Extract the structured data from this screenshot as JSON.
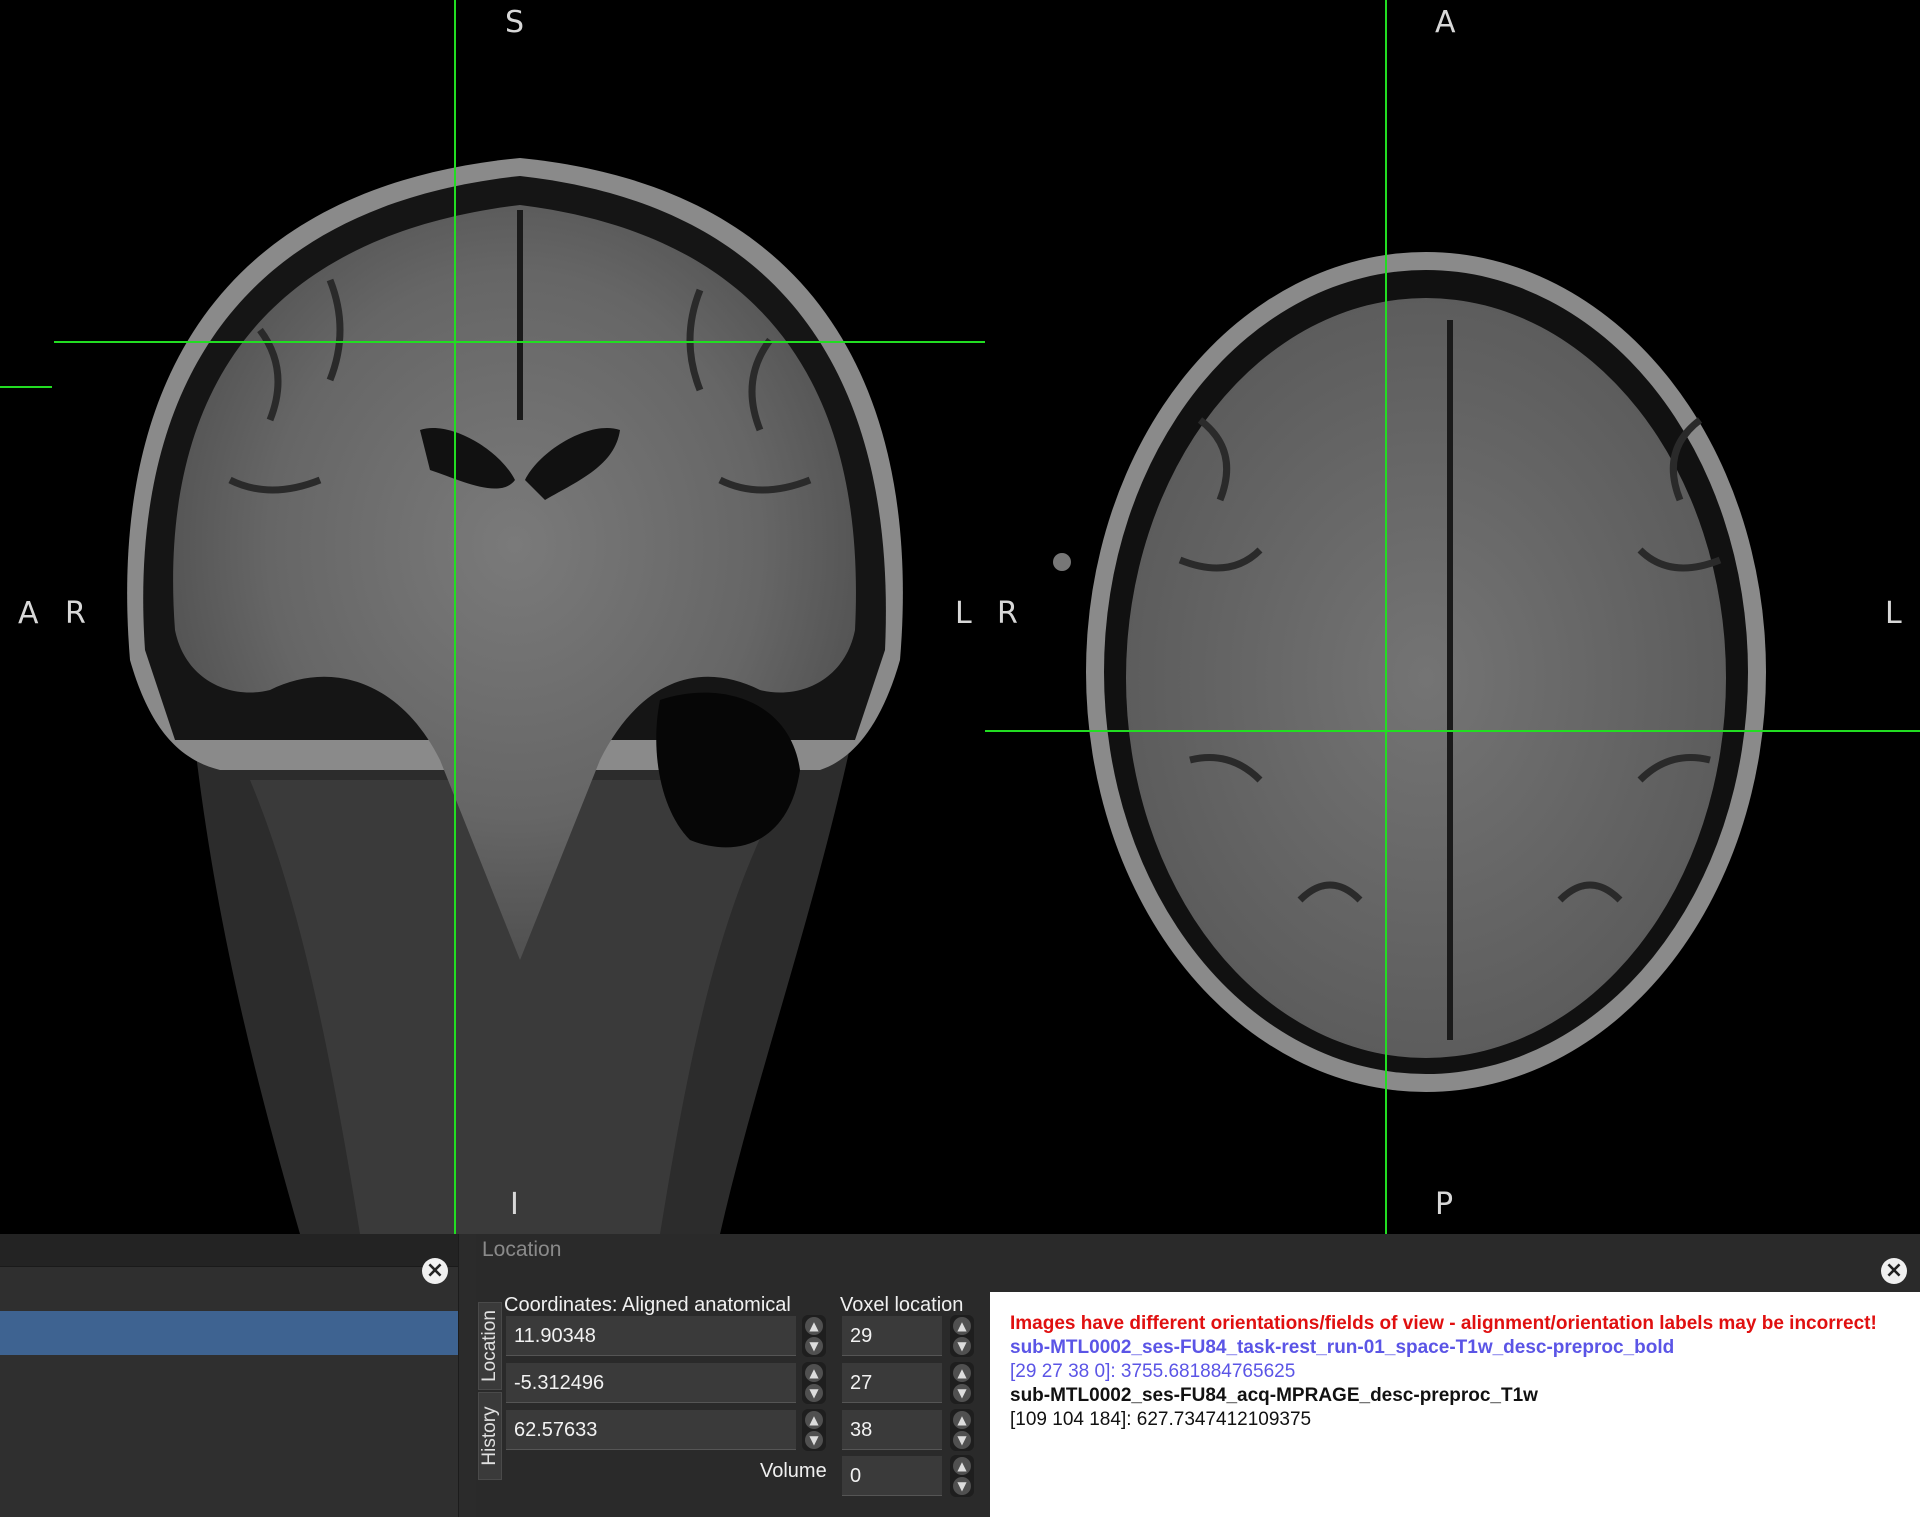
{
  "views": {
    "coronal": {
      "orientation": {
        "top": "S",
        "bottom": "I",
        "left": "R",
        "right": "L",
        "far_left": "A"
      }
    },
    "axial": {
      "orientation": {
        "top": "A",
        "bottom": "P",
        "left": "R",
        "right": "L"
      }
    },
    "crosshair_color": "#22dd22"
  },
  "left_panel": {
    "close_icon": "close-circle-icon"
  },
  "location_panel": {
    "title": "Location",
    "close_icon": "close-circle-icon",
    "tabs": [
      "Location",
      "History"
    ],
    "coordinates_label": "Coordinates: Aligned anatomical",
    "voxel_label": "Voxel location",
    "coordinates": [
      "11.90348",
      "-5.312496",
      "62.57633"
    ],
    "voxels": [
      "29",
      "27",
      "38"
    ],
    "volume_label": "Volume",
    "volume_value": "0"
  },
  "info": {
    "warning": "Images have different orientations/fields of view - alignment/orientation labels may be incorrect!",
    "image1_name": "sub-MTL0002_ses-FU84_task-rest_run-01_space-T1w_desc-preproc_bold",
    "image1_value": "[29 27 38 0]: 3755.681884765625",
    "image2_name": "sub-MTL0002_ses-FU84_acq-MPRAGE_desc-preproc_T1w",
    "image2_value": "[109 104 184]: 627.7347412109375"
  }
}
